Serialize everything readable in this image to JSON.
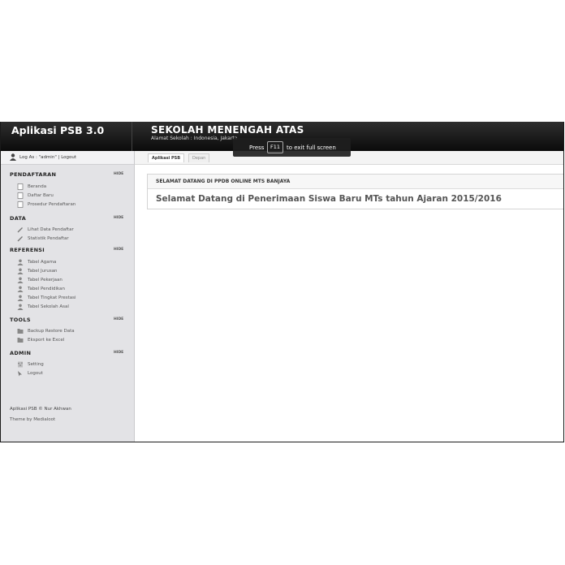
{
  "app": {
    "brand": "Aplikasi PSB 3.0",
    "school_name": "SEKOLAH MENENGAH ATAS",
    "school_address": "Alamat Sekolah : Indonesia, Jakarta"
  },
  "userbar": {
    "text": "Log As : \"admin\" | Logout"
  },
  "sidebar": {
    "hide_label": "HIDE",
    "sections": [
      {
        "title": "PENDAFTARAN",
        "items": [
          {
            "label": "Beranda",
            "icon": "page-icon"
          },
          {
            "label": "Daftar Baru",
            "icon": "page-icon"
          },
          {
            "label": "Prosedur Pendaftaran",
            "icon": "page-icon"
          }
        ]
      },
      {
        "title": "DATA",
        "items": [
          {
            "label": "Lihat Data Pendaftar",
            "icon": "pencil-icon"
          },
          {
            "label": "Statistik Pendaftar",
            "icon": "pencil-icon"
          }
        ]
      },
      {
        "title": "REFERENSI",
        "items": [
          {
            "label": "Tabel Agama",
            "icon": "user-icon"
          },
          {
            "label": "Tabel Jurusan",
            "icon": "user-icon"
          },
          {
            "label": "Tabel Pekerjaan",
            "icon": "user-icon"
          },
          {
            "label": "Tabel Pendidikan",
            "icon": "user-icon"
          },
          {
            "label": "Tabel Tingkat Prestasi",
            "icon": "user-icon"
          },
          {
            "label": "Tabel Sekolah Asal",
            "icon": "user-icon"
          }
        ]
      },
      {
        "title": "TOOLS",
        "items": [
          {
            "label": "Backup Restore Data",
            "icon": "folder-icon"
          },
          {
            "label": "Eksport ke Excel",
            "icon": "folder-icon"
          }
        ]
      },
      {
        "title": "ADMIN",
        "items": [
          {
            "label": "Setting",
            "icon": "sliders-icon"
          },
          {
            "label": "Logout",
            "icon": "cursor-icon"
          }
        ]
      }
    ],
    "footer_line1": "Aplikasi PSB © Nur Akhwan",
    "footer_line2": "Theme by Medialoot"
  },
  "tabs": [
    {
      "label": "Aplikasi PSB",
      "active": true
    },
    {
      "label": "Depan",
      "active": false
    }
  ],
  "welcome": {
    "header": "SELAMAT DATANG DI PPDB ONLINE MTS BANJAYA",
    "message": "Selamat Datang di Penerimaan Siswa Baru MTs tahun Ajaran 2015/2016"
  },
  "fullscreen_notice": {
    "prefix": "Press",
    "key": "F11",
    "suffix": "to exit full screen"
  }
}
